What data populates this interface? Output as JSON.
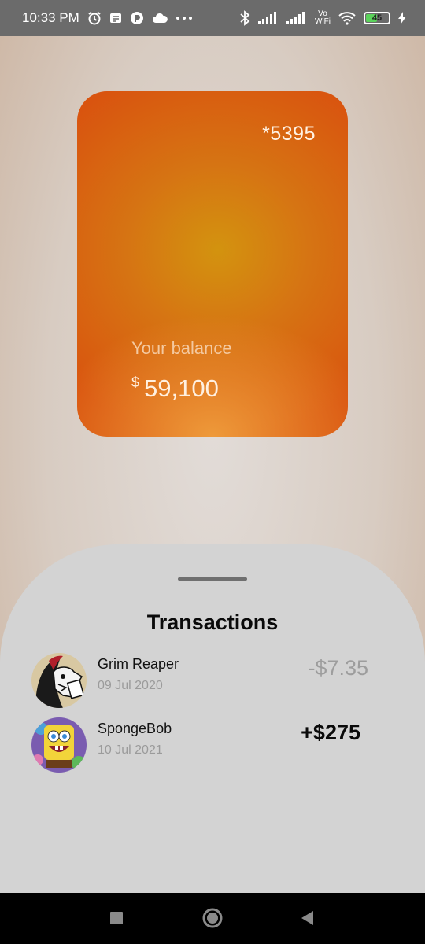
{
  "status_bar": {
    "time": "10:33 PM",
    "vo": "Vo",
    "wifi_label": "WiFi",
    "battery": "45",
    "icons": [
      "alarm-icon",
      "notification-icon",
      "app-icon",
      "cloud-icon",
      "more-icon",
      "bluetooth-icon",
      "signal-icon",
      "wifi-icon",
      "battery-icon",
      "charging-icon"
    ]
  },
  "card": {
    "number": "*5395",
    "balance_label": "Your balance",
    "currency": "$",
    "balance": "59,100",
    "colors": {
      "center": "#d3930f",
      "edge": "#d9540f"
    }
  },
  "sheet": {
    "title": "Transactions",
    "transactions": [
      {
        "name": "Grim Reaper",
        "date": "09 Jul 2020",
        "amount": "-$7.35",
        "avatar": "grim-reaper-avatar"
      },
      {
        "name": "SpongeBob",
        "date": "10 Jul 2021",
        "amount": "+$275",
        "avatar": "spongebob-avatar"
      }
    ]
  },
  "nav": {
    "icons": [
      "recents-square-icon",
      "home-circle-icon",
      "back-triangle-icon"
    ]
  }
}
